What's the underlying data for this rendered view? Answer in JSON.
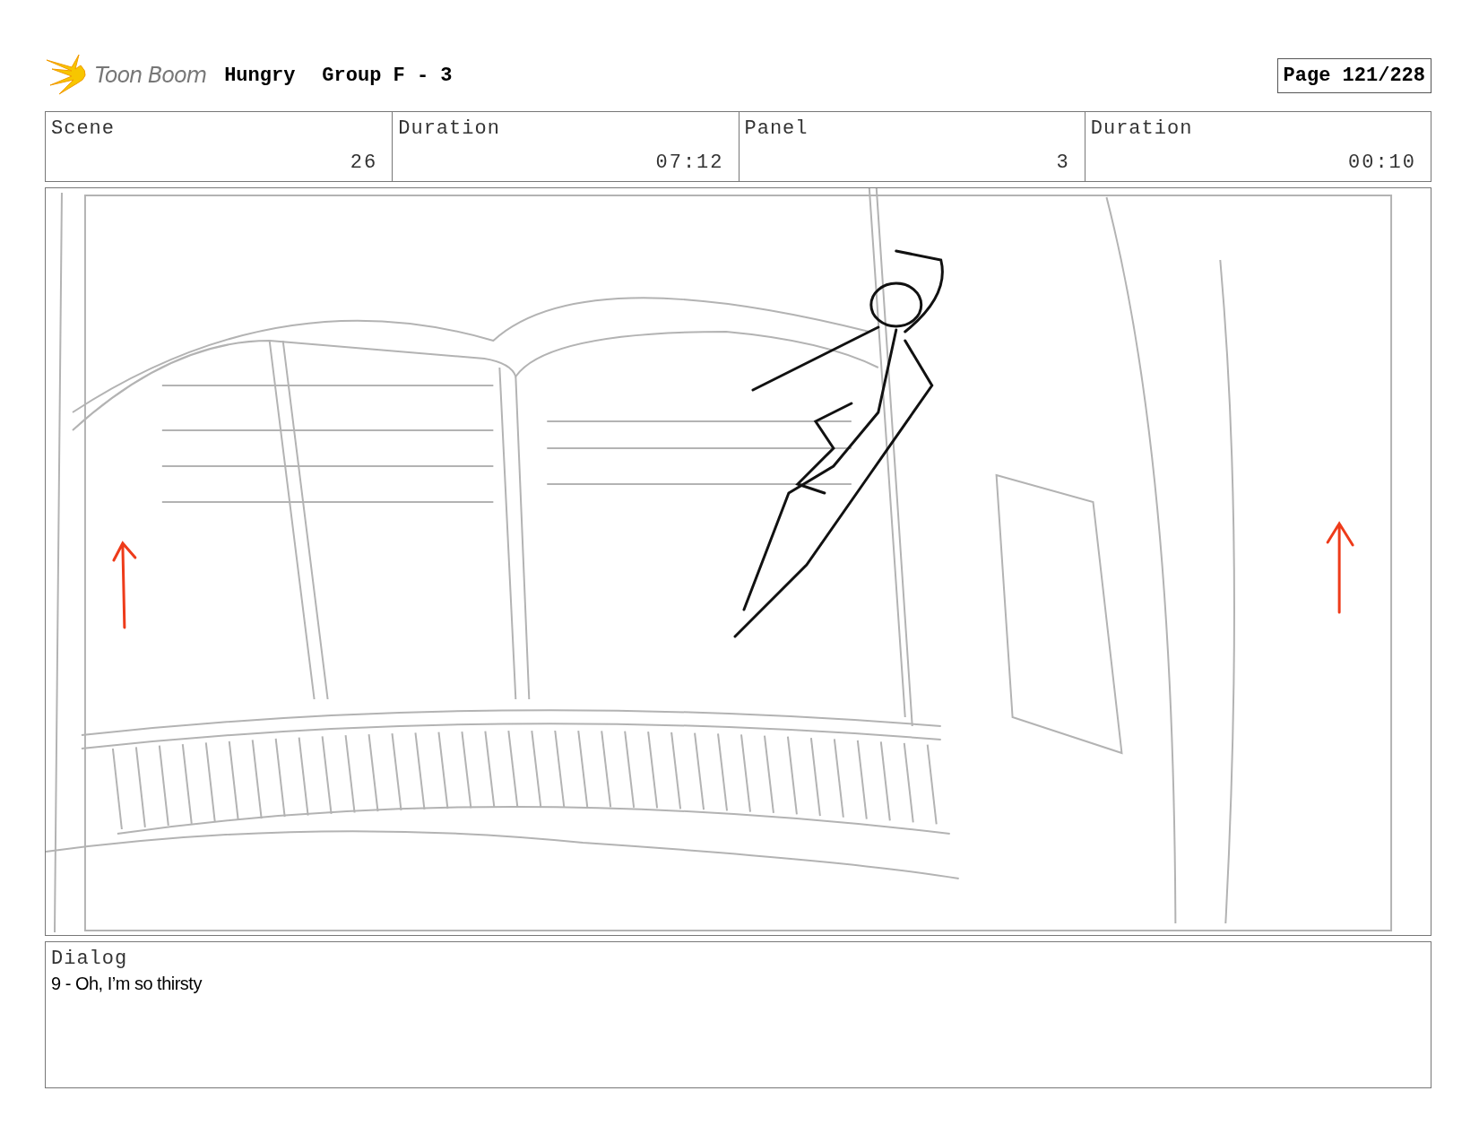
{
  "header": {
    "logo": "Toon Boom",
    "project": "Hungry",
    "sequence": "Group F - 3",
    "page": "Page 121/228"
  },
  "info": [
    {
      "label": "Scene",
      "value": "26"
    },
    {
      "label": "Duration",
      "value": "07:12"
    },
    {
      "label": "Panel",
      "value": "3"
    },
    {
      "label": "Duration",
      "value": "00:10"
    }
  ],
  "dialog": {
    "label": "Dialog",
    "text": "9 - Oh, I’m so thirsty"
  }
}
